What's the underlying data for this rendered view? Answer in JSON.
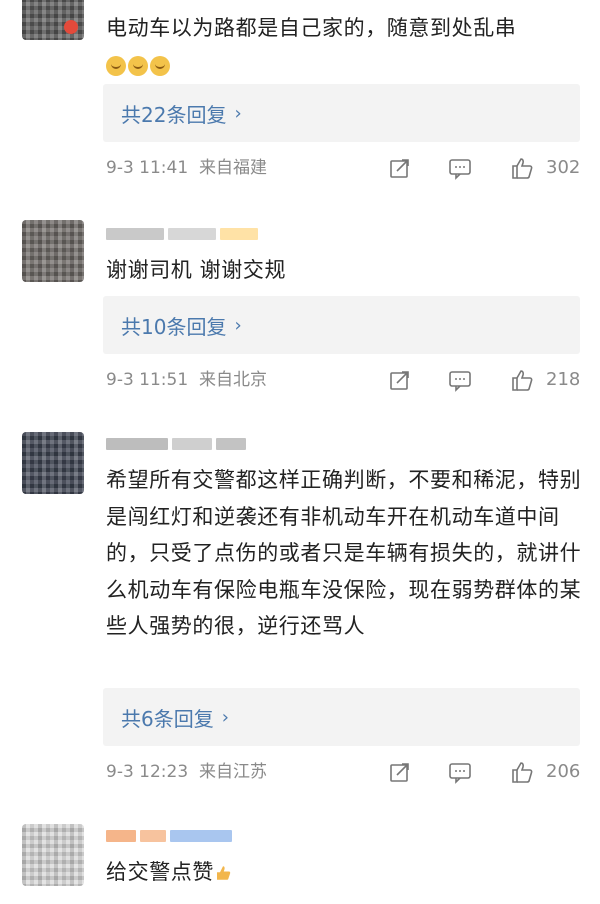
{
  "comments": [
    {
      "text": "电动车以为路都是自己家的，随意到处乱串",
      "emoji_count": 3,
      "replies_label": "共22条回复",
      "time": "9-3 11:41",
      "location": "来自福建",
      "likes": "302"
    },
    {
      "text": "谢谢司机 谢谢交规",
      "replies_label": "共10条回复",
      "time": "9-3 11:51",
      "location": "来自北京",
      "likes": "218"
    },
    {
      "text": "希望所有交警都这样正确判断，不要和稀泥，特别是闯红灯和逆袭还有非机动车开在机动车道中间的，只受了点伤的或者只是车辆有损失的，就讲什么机动车有保险电瓶车没保险，现在弱势群体的某些人强势的很，逆行还骂人",
      "replies_label": "共6条回复",
      "time": "9-3 12:23",
      "location": "来自江苏",
      "likes": "206"
    },
    {
      "text": "给交警点赞"
    }
  ],
  "icons": {
    "repost": "repost-icon",
    "comment": "comment-icon",
    "like": "like-icon",
    "chevron": "chevron-right-icon",
    "thumbs_emoji": "thumbs-up-emoji-icon"
  },
  "colors": {
    "link": "#4b79ad",
    "muted": "#8a8a8a",
    "reply_bg": "#f3f3f3"
  }
}
